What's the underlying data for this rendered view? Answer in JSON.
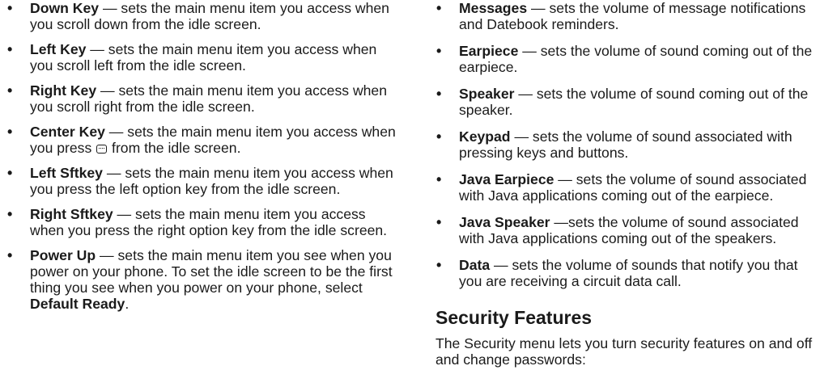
{
  "left_column": {
    "items": [
      {
        "term": "Down Key",
        "text": " — sets the main menu item you access when you scroll down from the idle screen."
      },
      {
        "term": "Left Key",
        "text": " — sets the main menu item you access when you scroll left from the idle screen."
      },
      {
        "term": "Right Key",
        "text": " — sets the main menu item you access when you scroll right from the idle screen."
      },
      {
        "term": "Center Key",
        "text_before_icon": " — sets the main menu item you access when you press ",
        "icon": "ok-key-icon",
        "text_after_icon": " from the idle screen."
      },
      {
        "term": "Left Sftkey",
        "text": " — sets the main menu item you access when you press the left option key from the idle screen."
      },
      {
        "term": "Right Sftkey",
        "text": " — sets the main menu item you access when you press the right option key from the idle screen."
      },
      {
        "term": "Power Up",
        "text": " — sets the main menu item you see when you power on your phone. To set the idle screen to be the first thing you see when you power on your phone, select ",
        "emphasis": "Default Ready",
        "text_end": "."
      }
    ]
  },
  "right_column": {
    "items": [
      {
        "term": "Messages",
        "text": " — sets the volume of message notifications and Datebook reminders."
      },
      {
        "term": "Earpiece",
        "text": " — sets the volume of sound coming out of the earpiece."
      },
      {
        "term": "Speaker",
        "text": " — sets the volume of sound coming out of the speaker."
      },
      {
        "term": "Keypad",
        "text": " — sets the volume of sound associated with pressing keys and buttons."
      },
      {
        "term": "Java Earpiece",
        "text": " — sets the volume of sound associated with Java applications coming out of the earpiece."
      },
      {
        "term": "Java Speaker",
        "text": " —sets the volume of sound associated with Java applications coming out of the speakers."
      },
      {
        "term": "Data",
        "text": " — sets the volume of sounds that notify you that you are receiving a circuit data call."
      }
    ],
    "section_heading": "Security Features",
    "intro": "The Security menu lets you turn security features on and off and change passwords:"
  }
}
